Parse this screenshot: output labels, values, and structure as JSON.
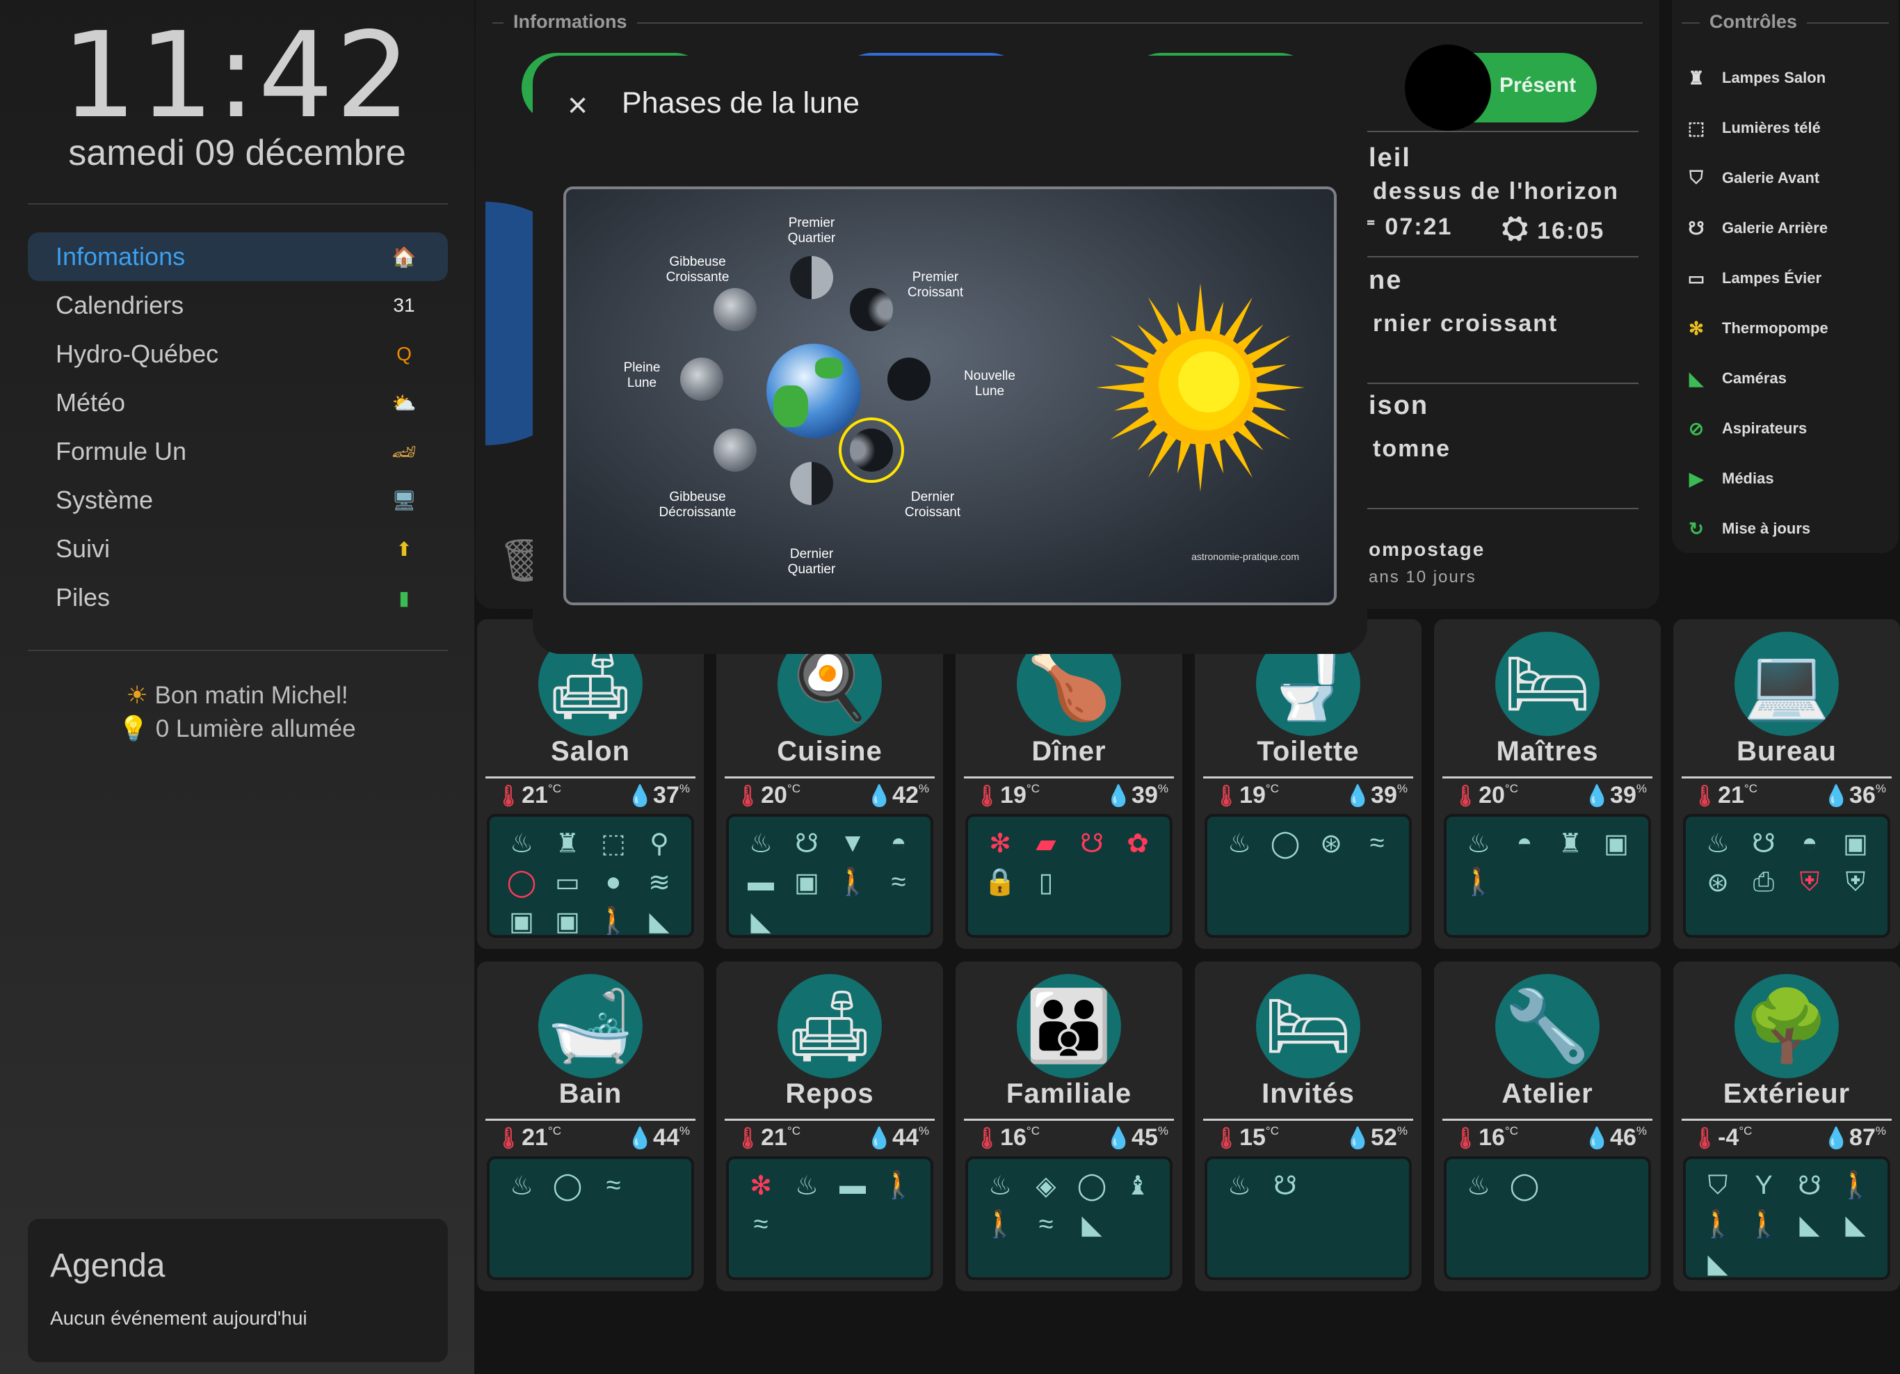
{
  "clock": {
    "time": "11:42",
    "date": "samedi 09 décembre"
  },
  "nav": [
    {
      "label": "Infomations",
      "icon": "home-icon",
      "glyph": "🏠",
      "color": "#3d7be0"
    },
    {
      "label": "Calendriers",
      "icon": "calendar-icon",
      "glyph": "31",
      "color": "#eaeaea"
    },
    {
      "label": "Hydro-Québec",
      "icon": "hydro-icon",
      "glyph": "Q",
      "color": "#f08a00"
    },
    {
      "label": "Météo",
      "icon": "weather-icon",
      "glyph": "⛅",
      "color": "#f0c040"
    },
    {
      "label": "Formule Un",
      "icon": "formula1-icon",
      "glyph": "🏎",
      "color": "#d9a34a"
    },
    {
      "label": "Système",
      "icon": "computer-icon",
      "glyph": "🖥",
      "color": "#8bc"
    },
    {
      "label": "Suivi",
      "icon": "package-icon",
      "glyph": "⬆",
      "color": "#e8c020"
    },
    {
      "label": "Piles",
      "icon": "battery-icon",
      "glyph": "▮",
      "color": "#3cba54"
    }
  ],
  "greeting": {
    "line1": "Bon matin Michel!",
    "line2": "0 Lumière allumée"
  },
  "agenda": {
    "title": "Agenda",
    "text": "Aucun événement aujourd'hui"
  },
  "info": {
    "section_title": "Informations",
    "presence": "Présent",
    "sun_title": "leil",
    "sun_state": "dessus de l'horizon",
    "sunrise": "07:21",
    "sunset": "16:05",
    "moon_title": "ne",
    "moon_state": "rnier croissant",
    "season_title": "ison",
    "season_state": "tomne",
    "compost_title": "ompostage",
    "compost_when": "ans 10 jours"
  },
  "controls": {
    "title": "Contrôles",
    "items": [
      {
        "label": "Lampes Salon",
        "icon": "floor-lamp-icon",
        "glyph": "♜"
      },
      {
        "label": "Lumières télé",
        "icon": "tv-light-icon",
        "glyph": "⬚"
      },
      {
        "label": "Galerie Avant",
        "icon": "porch-light-icon",
        "glyph": "⛉"
      },
      {
        "label": "Galerie Arrière",
        "icon": "ceiling-light-icon",
        "glyph": "☋"
      },
      {
        "label": "Lampes Évier",
        "icon": "sink-light-icon",
        "glyph": "▭"
      },
      {
        "label": "Thermopompe",
        "icon": "heat-pump-icon",
        "glyph": "✻"
      },
      {
        "label": "Caméras",
        "icon": "camera-icon",
        "glyph": "◣"
      },
      {
        "label": "Aspirateurs",
        "icon": "vacuum-icon",
        "glyph": "⊘"
      },
      {
        "label": "Médias",
        "icon": "play-icon",
        "glyph": "▶"
      },
      {
        "label": "Mise à jours",
        "icon": "update-icon",
        "glyph": "↻"
      }
    ]
  },
  "modal": {
    "title": "Phases de la lune",
    "close": "×",
    "labels": {
      "pq": "Premier\nQuartier",
      "gc": "Gibbeuse\nCroissante",
      "pc": "Premier\nCroissant",
      "pl": "Pleine\nLune",
      "nl": "Nouvelle\nLune",
      "gd": "Gibbeuse\nDécroissante",
      "dc": "Dernier\nCroissant",
      "dq": "Dernier\nQuartier"
    },
    "credit": "astronomie-pratique.com"
  },
  "rooms": [
    {
      "name": "Salon",
      "temp": "21",
      "hum": "37",
      "emoji": "🛋",
      "devices": [
        [
          "heater-icon",
          "♨"
        ],
        [
          "floor-lamp-icon",
          "♜"
        ],
        [
          "tv-light-icon",
          "⬚"
        ],
        [
          "desk-lamp-icon",
          "⚲"
        ],
        [
          "ceiling-light-icon",
          "◯",
          true
        ],
        [
          "tv-icon",
          "▭"
        ],
        [
          "apple-icon",
          "●"
        ],
        [
          "spotify-icon",
          "≋"
        ],
        [
          "outlet-icon",
          "▣"
        ],
        [
          "outlet-icon",
          "▣"
        ],
        [
          "motion-icon",
          "🚶"
        ],
        [
          "camera-icon",
          "◣"
        ]
      ]
    },
    {
      "name": "Cuisine",
      "temp": "20",
      "hum": "42",
      "emoji": "🍳",
      "devices": [
        [
          "heater-icon",
          "♨"
        ],
        [
          "ceiling-light-icon",
          "☋"
        ],
        [
          "pendant-light-icon",
          "▼"
        ],
        [
          "dome-light-icon",
          "◓"
        ],
        [
          "hood-icon",
          "▬"
        ],
        [
          "outlet-icon",
          "▣"
        ],
        [
          "motion-icon",
          "🚶"
        ],
        [
          "vibration-icon",
          "≈"
        ],
        [
          "camera-icon",
          "◣"
        ]
      ]
    },
    {
      "name": "Dîner",
      "temp": "19",
      "hum": "39",
      "emoji": "🍗",
      "devices": [
        [
          "ac-icon",
          "✻",
          true
        ],
        [
          "strip-light-icon",
          "▰",
          true
        ],
        [
          "chandelier-icon",
          "☋",
          true
        ],
        [
          "flower-icon",
          "✿",
          true
        ],
        [
          "lock-icon",
          "🔒"
        ],
        [
          "door-icon",
          "▯"
        ]
      ]
    },
    {
      "name": "Toilette",
      "temp": "19",
      "hum": "39",
      "emoji": "🚽",
      "devices": [
        [
          "heater-icon",
          "♨"
        ],
        [
          "ceiling-light-icon",
          "◯"
        ],
        [
          "fan-icon",
          "⊛"
        ],
        [
          "vibration-icon",
          "≈"
        ]
      ]
    },
    {
      "name": "Maîtres",
      "temp": "20",
      "hum": "39",
      "emoji": "🛏",
      "devices": [
        [
          "heater-icon",
          "♨"
        ],
        [
          "ceiling-light-icon",
          "◓"
        ],
        [
          "lamp-icon",
          "♜"
        ],
        [
          "outlet-icon",
          "▣"
        ],
        [
          "motion-icon",
          "🚶"
        ]
      ]
    },
    {
      "name": "Bureau",
      "temp": "21",
      "hum": "36",
      "emoji": "💻",
      "devices": [
        [
          "heater-icon",
          "♨"
        ],
        [
          "chandelier-icon",
          "☋"
        ],
        [
          "dome-light-icon",
          "◓"
        ],
        [
          "outlet-icon",
          "▣"
        ],
        [
          "fan-icon",
          "⊛"
        ],
        [
          "printer-icon",
          "⎙"
        ],
        [
          "shield-icon",
          "⛨",
          true
        ],
        [
          "shield-icon",
          "⛨"
        ]
      ]
    },
    {
      "name": "Bain",
      "temp": "21",
      "hum": "44",
      "emoji": "🛁",
      "devices": [
        [
          "heater-icon",
          "♨"
        ],
        [
          "ceiling-light-icon",
          "◯"
        ],
        [
          "vibration-icon",
          "≈"
        ]
      ]
    },
    {
      "name": "Repos",
      "temp": "21",
      "hum": "44",
      "emoji": "🛋",
      "devices": [
        [
          "ac-icon",
          "✻",
          true
        ],
        [
          "heater-icon",
          "♨"
        ],
        [
          "hood-icon",
          "▬"
        ],
        [
          "motion-icon",
          "🚶"
        ],
        [
          "vibration-icon",
          "≈"
        ]
      ]
    },
    {
      "name": "Familiale",
      "temp": "16",
      "hum": "45",
      "emoji": "👪",
      "devices": [
        [
          "heater-icon",
          "♨"
        ],
        [
          "ceiling-light-icon",
          "◈"
        ],
        [
          "ceiling-light-icon",
          "◯"
        ],
        [
          "lamp-icon",
          "♝"
        ],
        [
          "motion-icon",
          "🚶"
        ],
        [
          "vibration-icon",
          "≈"
        ],
        [
          "camera-icon",
          "◣"
        ]
      ]
    },
    {
      "name": "Invités",
      "temp": "15",
      "hum": "52",
      "emoji": "🛏",
      "devices": [
        [
          "heater-icon",
          "♨"
        ],
        [
          "chandelier-icon",
          "☋"
        ]
      ]
    },
    {
      "name": "Atelier",
      "temp": "16",
      "hum": "46",
      "emoji": "🔧",
      "devices": [
        [
          "heater-icon",
          "♨"
        ],
        [
          "ceiling-light-icon",
          "◯"
        ]
      ]
    },
    {
      "name": "Extérieur",
      "temp": "-4",
      "hum": "87",
      "emoji": "🌳",
      "devices": [
        [
          "porch-light-icon",
          "⛉"
        ],
        [
          "post-light-icon",
          "Y"
        ],
        [
          "chandelier-icon",
          "☋"
        ],
        [
          "motion-icon",
          "🚶"
        ],
        [
          "motion-icon",
          "🚶"
        ],
        [
          "motion-icon",
          "🚶"
        ],
        [
          "camera-icon",
          "◣"
        ],
        [
          "camera-icon",
          "◣"
        ],
        [
          "camera-icon",
          "◣"
        ]
      ]
    }
  ]
}
